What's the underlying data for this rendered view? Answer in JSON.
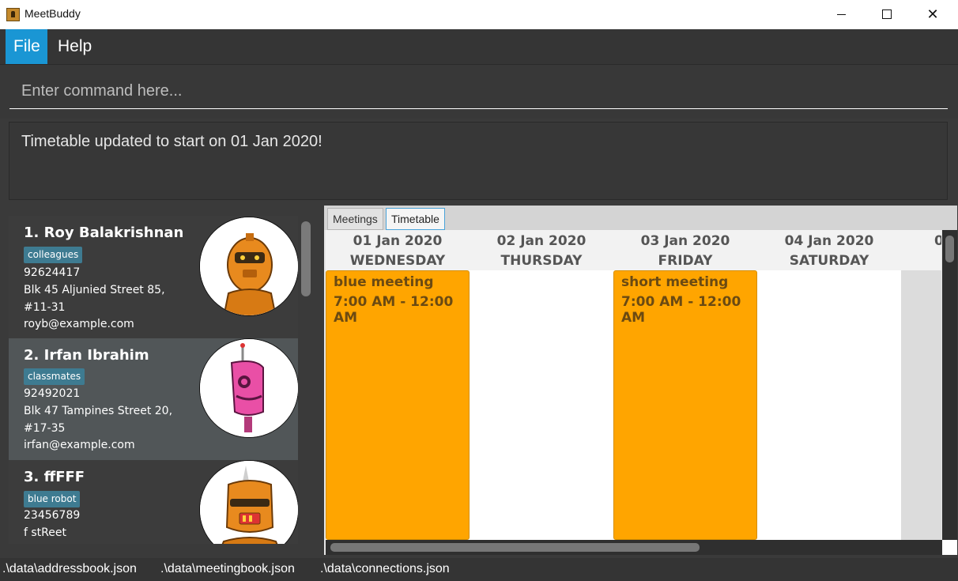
{
  "window": {
    "title": "MeetBuddy",
    "close_glyph": "✕"
  },
  "menu": {
    "items": [
      {
        "label": "File"
      },
      {
        "label": "Help"
      }
    ]
  },
  "command": {
    "placeholder": "Enter command here..."
  },
  "result": {
    "text": "Timetable updated to start on 01 Jan 2020!"
  },
  "persons": [
    {
      "index_name": "1.  Roy Balakrishnan",
      "tag": "colleagues",
      "phone": "92624417",
      "address_line1": "Blk 45 Aljunied Street 85,",
      "address_line2": "#11-31",
      "email": "royb@example.com"
    },
    {
      "index_name": "2.  Irfan Ibrahim",
      "tag": "classmates",
      "phone": "92492021",
      "address_line1": "Blk 47 Tampines Street 20,",
      "address_line2": "#17-35",
      "email": "irfan@example.com"
    },
    {
      "index_name": "3.  ffFFF",
      "tag": "blue robot",
      "phone": "23456789",
      "address_line1": "f stReet",
      "address_line2": "",
      "email": ""
    }
  ],
  "tabs": [
    {
      "label": "Meetings"
    },
    {
      "label": "Timetable"
    }
  ],
  "timetable": {
    "days": [
      {
        "date": "01 Jan 2020",
        "weekday": "WEDNESDAY"
      },
      {
        "date": "02 Jan 2020",
        "weekday": "THURSDAY"
      },
      {
        "date": "03 Jan 2020",
        "weekday": "FRIDAY"
      },
      {
        "date": "04 Jan 2020",
        "weekday": "SATURDAY"
      },
      {
        "date": "0",
        "weekday": ""
      }
    ],
    "meetings": [
      {
        "name": "blue meeting",
        "time": "7:00 AM - 12:00 AM"
      },
      {
        "name": "short meeting",
        "time": "7:00 AM - 12:00 AM"
      }
    ],
    "meeting_color": "#ffa500"
  },
  "status": {
    "items": [
      {
        "label": ".\\data\\addressbook.json"
      },
      {
        "label": ".\\data\\meetingbook.json"
      },
      {
        "label": ".\\data\\connections.json"
      }
    ]
  },
  "colors": {
    "accent": "#1a96d4",
    "tag": "#3e7b91",
    "meeting": "#ffa500"
  }
}
